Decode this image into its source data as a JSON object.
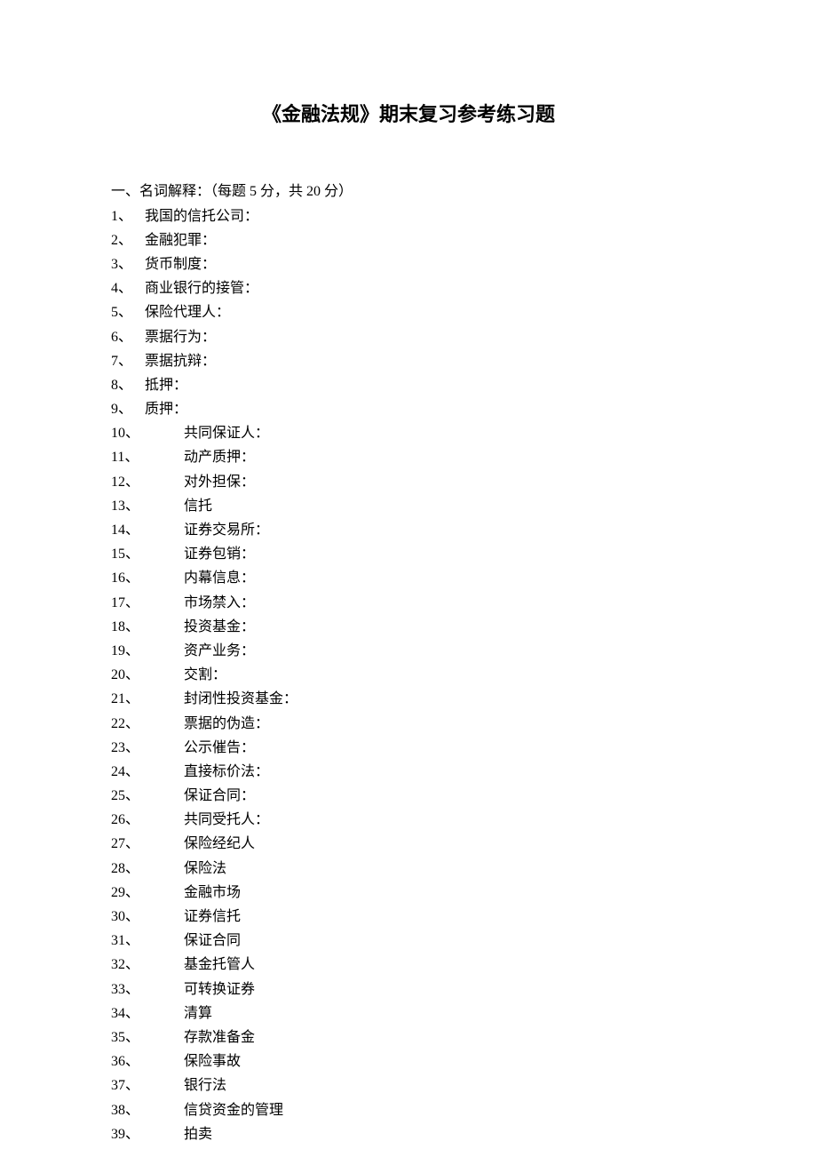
{
  "title": "《金融法规》期末复习参考练习题",
  "section_header": "一、名词解释：（每题 5 分，共 20 分）",
  "items": [
    {
      "num": "1、",
      "text": "我国的信托公司："
    },
    {
      "num": "2、",
      "text": "金融犯罪："
    },
    {
      "num": "3、",
      "text": "货币制度："
    },
    {
      "num": "4、",
      "text": "商业银行的接管："
    },
    {
      "num": "5、",
      "text": "保险代理人："
    },
    {
      "num": "6、",
      "text": "票据行为："
    },
    {
      "num": "7、",
      "text": "票据抗辩："
    },
    {
      "num": "8、",
      "text": "抵押："
    },
    {
      "num": "9、",
      "text": "质押："
    },
    {
      "num": "10、",
      "text": "共同保证人：",
      "wide": true
    },
    {
      "num": "11、",
      "text": "动产质押：",
      "wide": true
    },
    {
      "num": "12、",
      "text": "对外担保：",
      "wide": true
    },
    {
      "num": "13、",
      "text": "信托",
      "wide": true
    },
    {
      "num": "14、",
      "text": "证券交易所：",
      "wide": true
    },
    {
      "num": "15、",
      "text": "证券包销：",
      "wide": true
    },
    {
      "num": "16、",
      "text": "内幕信息：",
      "wide": true
    },
    {
      "num": "17、",
      "text": "市场禁入：",
      "wide": true
    },
    {
      "num": "18、",
      "text": "投资基金：",
      "wide": true
    },
    {
      "num": "19、",
      "text": "资产业务：",
      "wide": true
    },
    {
      "num": "20、",
      "text": "交割：",
      "wide": true
    },
    {
      "num": "21、",
      "text": "封闭性投资基金：",
      "wide": true
    },
    {
      "num": "22、",
      "text": "票据的伪造：",
      "wide": true
    },
    {
      "num": "23、",
      "text": "公示催告：",
      "wide": true
    },
    {
      "num": "24、",
      "text": "直接标价法：",
      "wide": true
    },
    {
      "num": "25、",
      "text": "保证合同：",
      "wide": true
    },
    {
      "num": "26、",
      "text": "共同受托人：",
      "wide": true
    },
    {
      "num": "27、",
      "text": "保险经纪人",
      "wide": true
    },
    {
      "num": "28、",
      "text": "保险法",
      "wide": true
    },
    {
      "num": "29、",
      "text": "金融市场",
      "wide": true
    },
    {
      "num": "30、",
      "text": "证券信托",
      "wide": true
    },
    {
      "num": "31、",
      "text": "保证合同",
      "wide": true
    },
    {
      "num": "32、",
      "text": "基金托管人",
      "wide": true
    },
    {
      "num": "33、",
      "text": "可转换证券",
      "wide": true
    },
    {
      "num": "34、",
      "text": "清算",
      "wide": true
    },
    {
      "num": "35、",
      "text": "存款准备金",
      "wide": true
    },
    {
      "num": "36、",
      "text": "保险事故",
      "wide": true
    },
    {
      "num": "37、",
      "text": "银行法",
      "wide": true
    },
    {
      "num": "38、",
      "text": "信贷资金的管理",
      "wide": true
    },
    {
      "num": "39、",
      "text": "拍卖",
      "wide": true
    }
  ]
}
